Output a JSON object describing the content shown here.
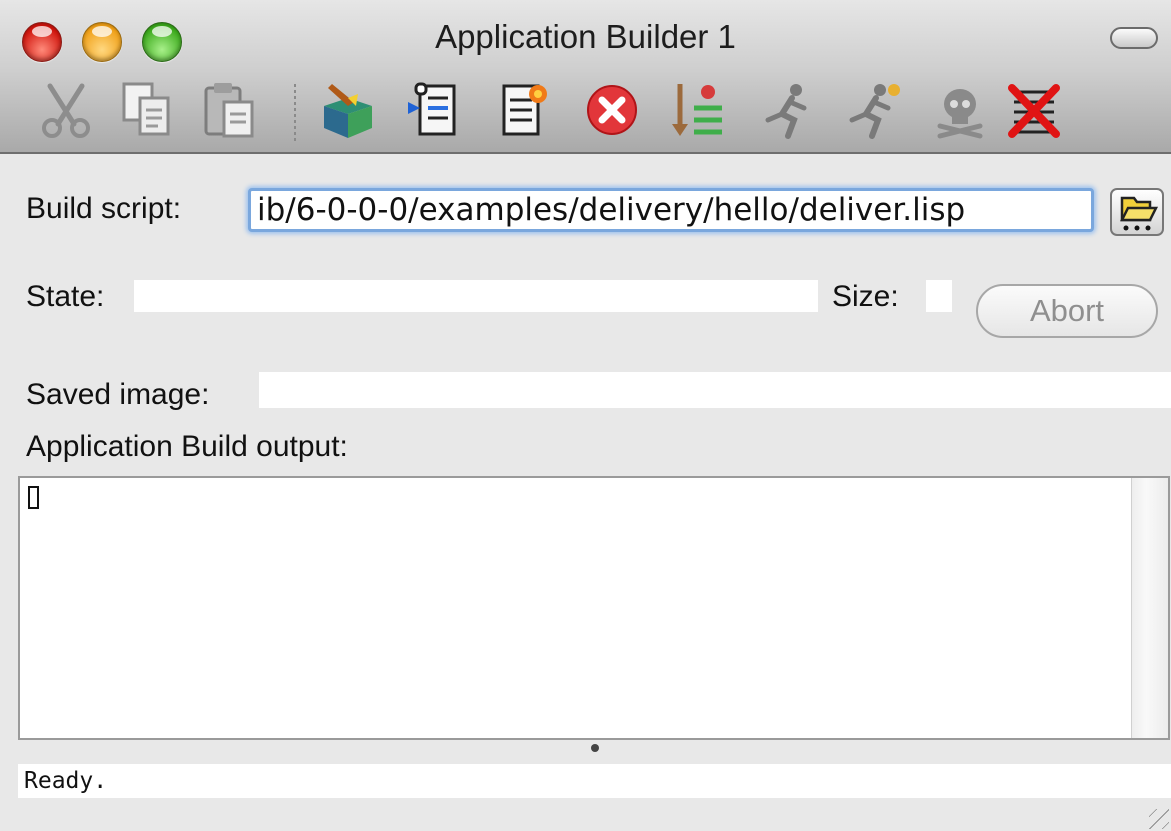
{
  "window": {
    "title": "Application Builder 1",
    "traffic_lights": [
      "close",
      "minimize",
      "zoom"
    ]
  },
  "toolbar": {
    "icons": [
      "cut-icon",
      "copy-icon",
      "paste-icon",
      "build-box-icon",
      "script-arrow-icon",
      "script-burst-icon",
      "stop-icon",
      "download-list-icon",
      "run-icon",
      "run-star-icon",
      "skull-icon",
      "clear-output-icon"
    ]
  },
  "form": {
    "build_script_label": "Build script:",
    "build_script_value": "ib/6-0-0-0/examples/delivery/hello/deliver.lisp",
    "state_label": "State:",
    "state_value": "",
    "size_label": "Size:",
    "size_value": "",
    "abort_label": "Abort",
    "saved_image_label": "Saved image:",
    "saved_image_value": "",
    "output_label": "Application Build output:"
  },
  "status": {
    "text": "Ready."
  },
  "colors": {
    "focus_ring": "#7aa7dd",
    "window_bg": "#e8e8e8",
    "close": "#d0140c",
    "minimize": "#f0a018",
    "zoom": "#3caa1c"
  }
}
